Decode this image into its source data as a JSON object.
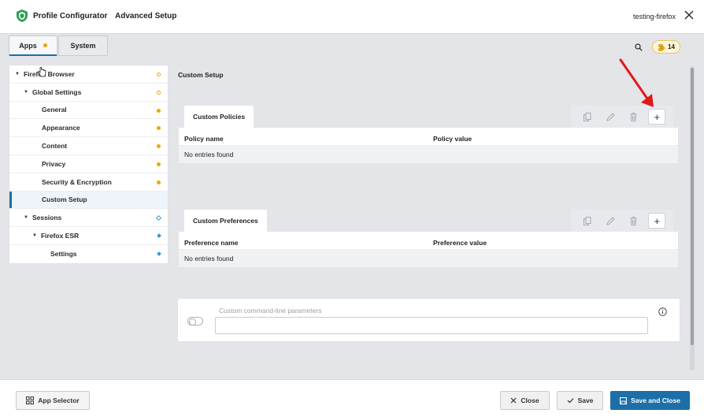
{
  "header": {
    "app_name": "Profile Configurator",
    "page_name": "Advanced Setup",
    "profile_name": "testing-firefox",
    "accent_color": "#1b6fa8"
  },
  "tabs": [
    {
      "label": "Apps",
      "active": true,
      "has_warning": true
    },
    {
      "label": "System",
      "active": false
    }
  ],
  "notifications": {
    "count": "14",
    "icon": "coin-stack-icon"
  },
  "tree": [
    {
      "label": "Firefox Browser",
      "level": 0,
      "expanded": true,
      "status": "ring-orange"
    },
    {
      "label": "Global Settings",
      "level": 1,
      "expanded": true,
      "status": "ring-orange"
    },
    {
      "label": "General",
      "level": 2,
      "status": "dot-orange"
    },
    {
      "label": "Appearance",
      "level": 2,
      "status": "dot-orange"
    },
    {
      "label": "Content",
      "level": 2,
      "status": "dot-orange"
    },
    {
      "label": "Privacy",
      "level": 2,
      "status": "dot-orange"
    },
    {
      "label": "Security & Encryption",
      "level": 2,
      "status": "dot-orange"
    },
    {
      "label": "Custom Setup",
      "level": 2,
      "active": true,
      "status": "none"
    },
    {
      "label": "Sessions",
      "level": 1,
      "expanded": true,
      "status": "diamond-blue-outline"
    },
    {
      "label": "Firefox ESR",
      "level": 2,
      "expanded": true,
      "status": "diamond-blue"
    },
    {
      "label": "Settings",
      "level": 3,
      "status": "diamond-blue"
    }
  ],
  "main": {
    "section_title": "Custom Setup",
    "policies": {
      "tab_label": "Custom Policies",
      "col_name": "Policy name",
      "col_value": "Policy value",
      "empty_text": "No entries found",
      "add_label": "+"
    },
    "preferences": {
      "tab_label": "Custom Preferences",
      "col_name": "Preference name",
      "col_value": "Preference value",
      "empty_text": "No entries found",
      "add_label": "+"
    },
    "command_line": {
      "label": "Custom command-line parameters",
      "value": "",
      "enabled": false
    }
  },
  "footer": {
    "app_selector": "App Selector",
    "close": "Close",
    "save": "Save",
    "save_and_close": "Save and Close"
  }
}
